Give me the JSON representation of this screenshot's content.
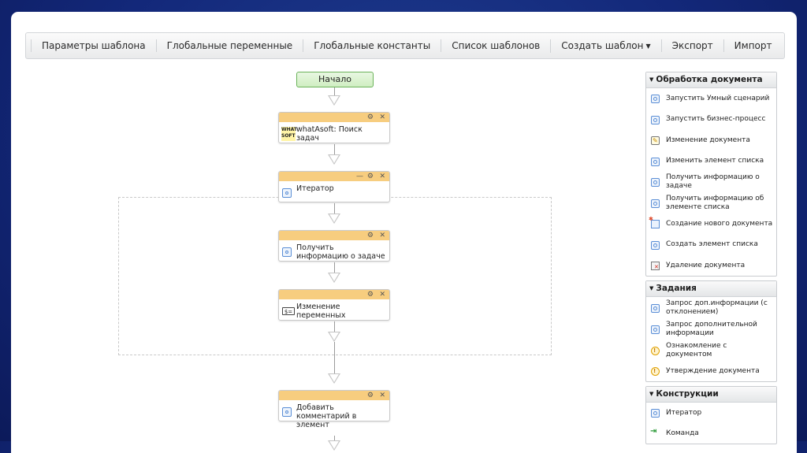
{
  "toolbar": {
    "items": [
      "Параметры шаблона",
      "Глобальные переменные",
      "Глобальные константы",
      "Список шаблонов",
      "Создать шаблон",
      "Экспорт",
      "Импорт"
    ]
  },
  "diagram": {
    "start": "Начало",
    "nodes": [
      {
        "text": "whatAsoft: Поиск задач",
        "logo": "WHAT SOFT"
      },
      {
        "text": "Итератор"
      },
      {
        "text": "Получить информацию о задаче"
      },
      {
        "text": "Изменение переменных"
      },
      {
        "text": "Добавить комментарий в элемент"
      }
    ],
    "controls": {
      "gear": "⚙",
      "close": "✕",
      "minimize": "—"
    }
  },
  "palette": {
    "groups": [
      {
        "title": "Обработка документа",
        "items": [
          "Запустить Умный сценарий",
          "Запустить бизнес-процесс",
          "Изменение документа",
          "Изменить элемент списка",
          "Получить информацию о задаче",
          "Получить информацию об элементе списка",
          "Создание нового документа",
          "Создать элемент списка",
          "Удаление документа"
        ]
      },
      {
        "title": "Задания",
        "items": [
          "Запрос доп.информации (с отклонением)",
          "Запрос дополнительной информации",
          "Ознакомление с документом",
          "Утверждение документа"
        ]
      },
      {
        "title": "Конструкции",
        "items": [
          "Итератор",
          "Команда"
        ]
      }
    ]
  },
  "colors": {
    "node_header": "#f7cd7f",
    "start_fill": "#cfeec1",
    "start_border": "#6bb35a",
    "background": "#13287a"
  }
}
